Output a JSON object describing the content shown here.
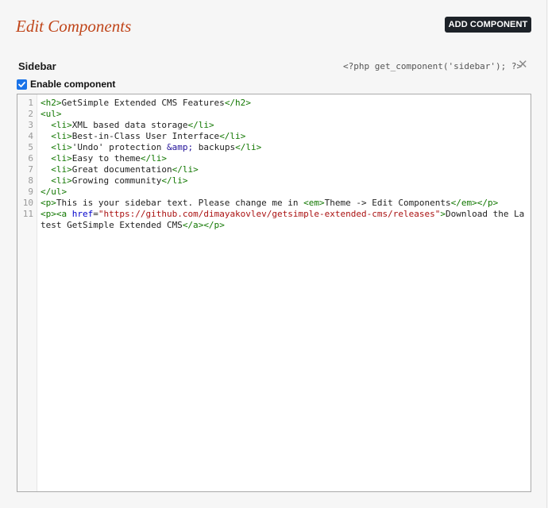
{
  "header": {
    "title": "Edit Components",
    "add_button_label": "ADD COMPONENT"
  },
  "component": {
    "name": "Sidebar",
    "code_snippet": "<?php get_component('sidebar'); ?>",
    "close_glyph": "✕",
    "enable_label": "Enable component",
    "enabled": true
  },
  "editor": {
    "line_numbers": [
      "1",
      "2",
      "3",
      "4",
      "5",
      "6",
      "7",
      "8",
      "9",
      "10",
      "11"
    ],
    "lines": [
      "<h2>GetSimple Extended CMS Features</h2>",
      "<ul>",
      "  <li>XML based data storage</li>",
      "  <li>Best-in-Class User Interface</li>",
      "  <li>'Undo' protection &amp; backups</li>",
      "  <li>Easy to theme</li>",
      "  <li>Great documentation</li>",
      "  <li>Growing community</li>",
      "</ul>",
      "<p>This is your sidebar text. Please change me in <em>Theme -> Edit Components</em></p>",
      "<p><a href=\"https://github.com/dimayakovlev/getsimple-extended-cms/releases\">Download the Latest GetSimple Extended CMS</a></p>"
    ]
  },
  "colors": {
    "title": "#c0461b",
    "button_bg": "#1d2228",
    "checkbox": "#1a73e8",
    "tag": "#117700",
    "attr": "#0000cc",
    "string": "#aa1111"
  }
}
